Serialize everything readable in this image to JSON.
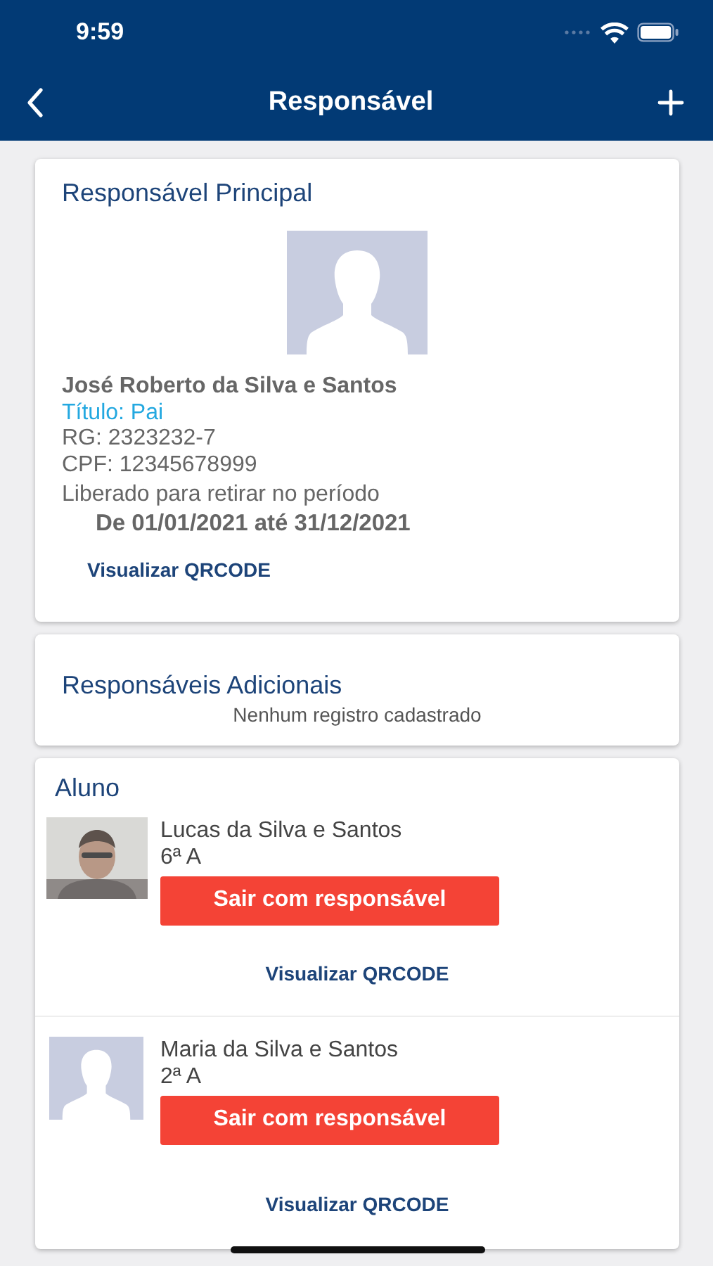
{
  "status_bar": {
    "time": "9:59"
  },
  "nav": {
    "title": "Responsável"
  },
  "principal": {
    "heading": "Responsável Principal",
    "name": "José Roberto da Silva e Santos",
    "title": "Título: Pai",
    "rg": "RG: 2323232-7",
    "cpf": "CPF: 12345678999",
    "period_label": "Liberado para retirar no período",
    "period": "De 01/01/2021 até 31/12/2021",
    "qr_link": "Visualizar QRCODE"
  },
  "additional": {
    "heading": "Responsáveis Adicionais",
    "empty": "Nenhum registro cadastrado"
  },
  "students": {
    "heading": "Aluno",
    "items": [
      {
        "kind": "picture",
        "name": "Lucas da Silva e Santos",
        "class": "6ª A",
        "button": "Sair com responsável",
        "qr_link": "Visualizar QRCODE"
      },
      {
        "kind": "placeholder",
        "name": "Maria da Silva e Santos",
        "class": "2ª A",
        "button": "Sair com responsável",
        "qr_link": "Visualizar QRCODE"
      }
    ]
  }
}
